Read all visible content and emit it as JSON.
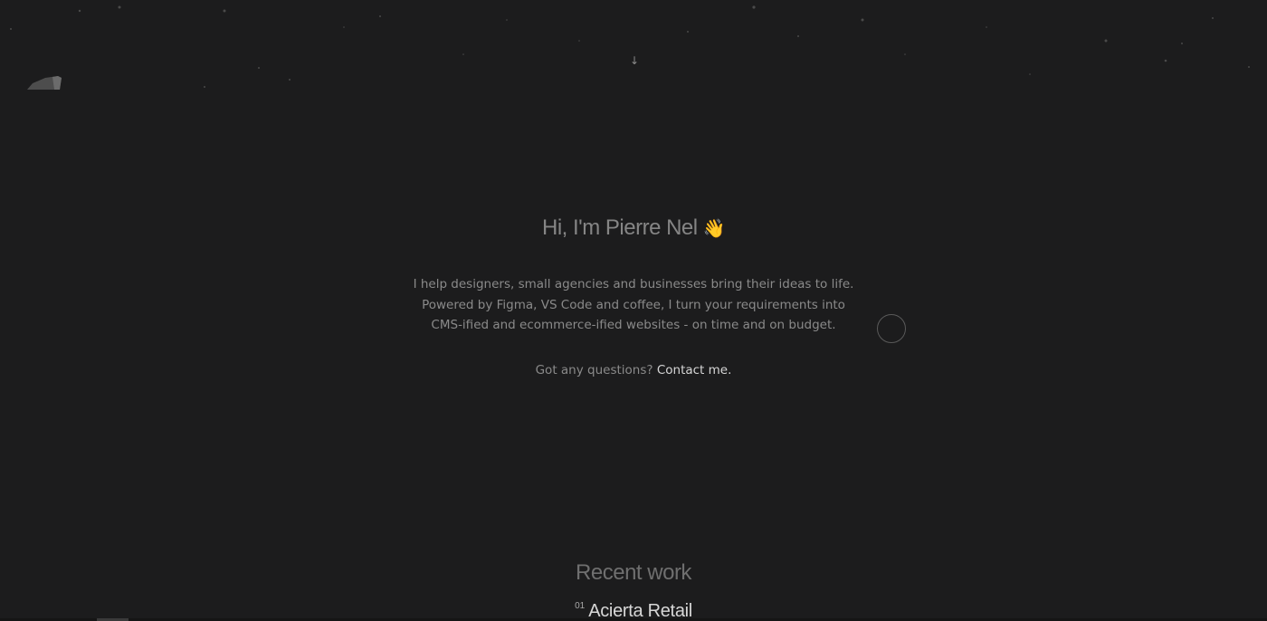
{
  "header": {
    "logo_icon": "mountain-logo-icon",
    "scroll_hint_icon": "arrow-down-icon",
    "scroll_hint_glyph": "↓"
  },
  "hero": {
    "title": "Hi, I'm Pierre Nel",
    "wave_icon": "waving-hand-icon",
    "wave_glyph": "👋",
    "intro": "I help designers, small agencies and businesses bring their ideas to life. Powered by Figma, VS Code and coffee, I turn your requirements into CMS-ified and ecommerce-ified websites - on time and on budget.",
    "contact_prefix": "Got any questions?",
    "contact_link": "Contact me."
  },
  "recent_work": {
    "title": "Recent work",
    "items": [
      {
        "number": "01",
        "name": "Acierta Retail"
      }
    ]
  },
  "colors": {
    "background": "#1c1c1d",
    "text_muted": "#8a8a8a",
    "text_highlight": "#d6d6d6"
  }
}
